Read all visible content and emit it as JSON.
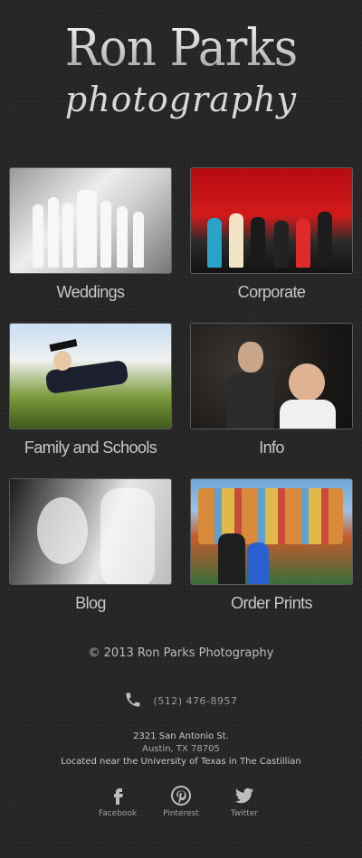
{
  "header": {
    "brand_main": "Ron Parks",
    "brand_sub": "photography"
  },
  "tiles": [
    {
      "label": "Weddings"
    },
    {
      "label": "Corporate"
    },
    {
      "label": "Family and Schools"
    },
    {
      "label": "Info"
    },
    {
      "label": "Blog"
    },
    {
      "label": "Order Prints"
    }
  ],
  "footer": {
    "copyright": "© 2013 Ron Parks Photography",
    "phone": "(512) 476-8957",
    "address_line1": "2321 San Antonio St.",
    "address_line2": "Austin, TX 78705",
    "address_line3": "Located near the University of Texas in The Castillian"
  },
  "social": [
    {
      "label": "Facebook",
      "icon": "facebook-icon"
    },
    {
      "label": "Pinterest",
      "icon": "pinterest-icon"
    },
    {
      "label": "Twitter",
      "icon": "twitter-icon"
    }
  ],
  "colors": {
    "background": "#262626",
    "caption": "#c8c8c8"
  }
}
